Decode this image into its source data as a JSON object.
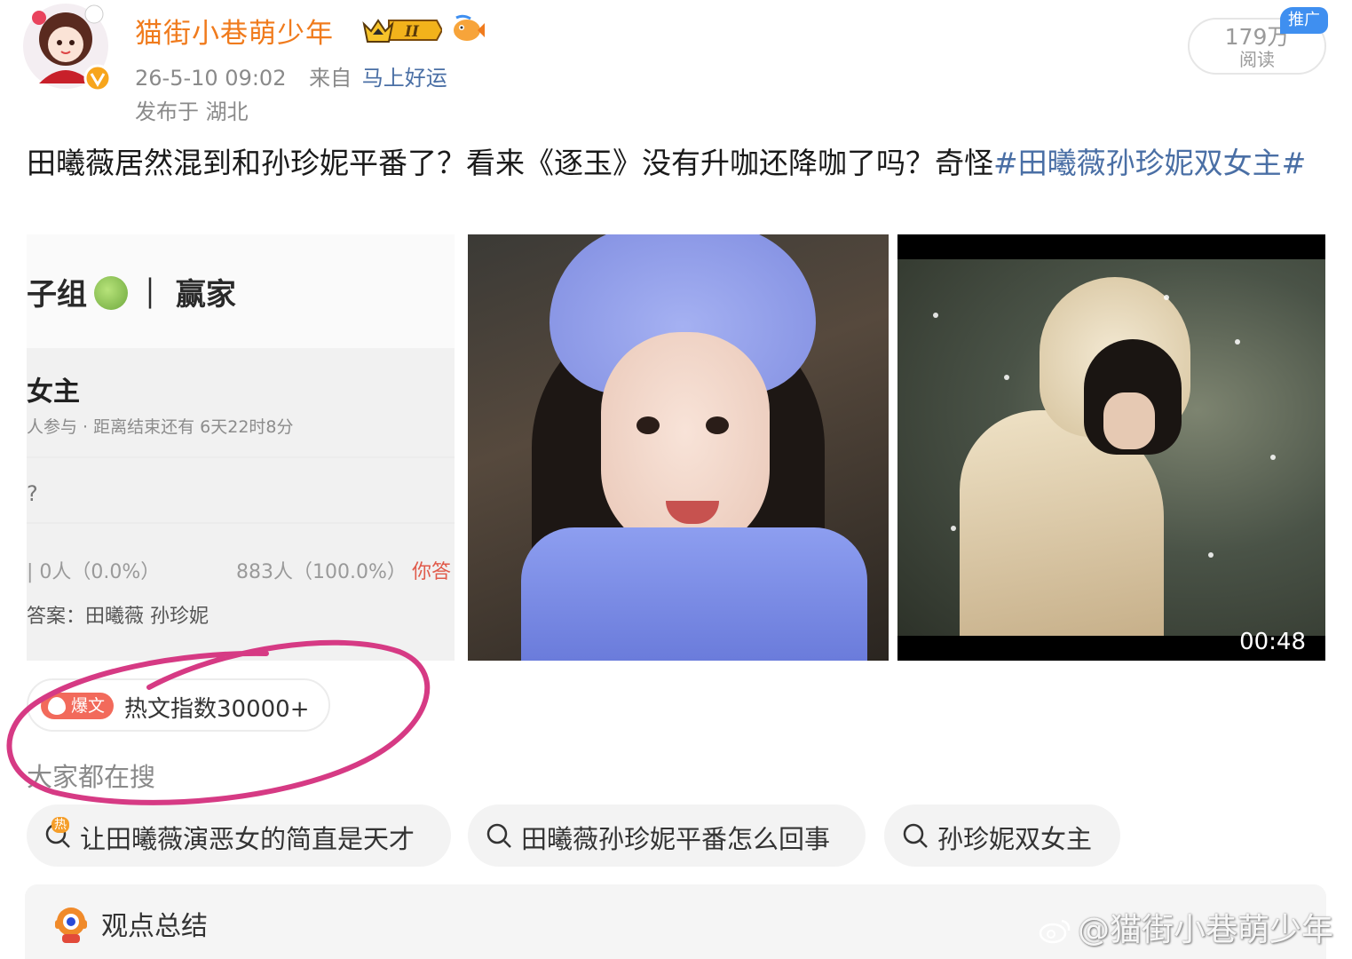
{
  "post": {
    "author": "猫街小巷萌少年",
    "badge_level": "II",
    "timestamp": "26-5-10 09:02",
    "source_label": "来自",
    "source_link": "马上好运",
    "location": "发布于 湖北",
    "reads_count": "179万",
    "reads_label": "阅读",
    "promo_tag": "推广",
    "text_main": "田曦薇居然混到和孙珍妮平番了？看来《逐玉》没有升咖还降咖了吗？奇怪",
    "hashtag": "#田曦薇孙珍妮双女主#"
  },
  "images": {
    "poll": {
      "heading": "子组",
      "heading_after": "｜ 赢家",
      "title": "女主",
      "subtitle": "人参与 · 距离结束还有 6天22时8分",
      "question": "?",
      "stat_a": "| 0人（0.0%）",
      "stat_b": "883人（100.0%）",
      "you_answered": "你答",
      "answer": "答案：田曦薇 孙珍妮"
    },
    "video_duration": "00:48"
  },
  "hot": {
    "tag": "爆文",
    "index_text": "热文指数30000+"
  },
  "search": {
    "heading": "大家都在搜",
    "hot_mini": "热",
    "chips": [
      "让田曦薇演恶女的简直是天才",
      "田曦薇孙珍妮平番怎么回事",
      "孙珍妮双女主"
    ]
  },
  "summary": {
    "label": "观点总结"
  },
  "watermark": "@猫街小巷萌少年",
  "colors": {
    "username": "#f07b1d",
    "link": "#4a6fa5",
    "hot_tag": "#f26a5b",
    "promo": "#3f8ff0",
    "annotation": "#d63a84"
  },
  "icons": [
    "avatar",
    "crown-badge-icon",
    "fish-badge-icon",
    "verified-icon",
    "fire-icon",
    "search-icon",
    "summary-robot-icon",
    "weibo-icon"
  ]
}
